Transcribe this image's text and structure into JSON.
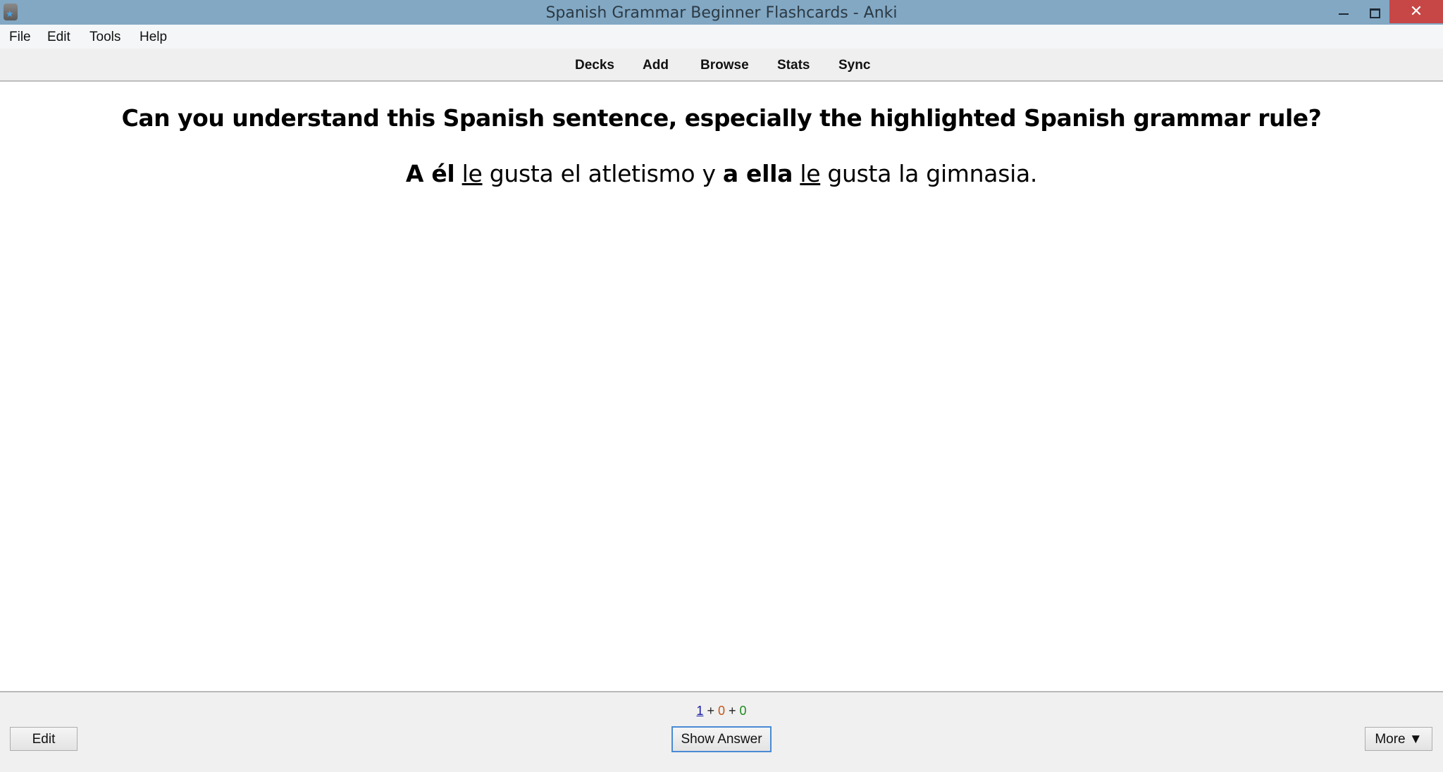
{
  "window": {
    "title": "Spanish Grammar Beginner Flashcards - Anki",
    "icons": {
      "app": "anki-star-icon",
      "minimize": "minimize-icon",
      "restore": "restore-icon",
      "close": "close-icon"
    },
    "close_glyph": "✕"
  },
  "menubar": {
    "items": [
      {
        "label": "File"
      },
      {
        "label": "Edit"
      },
      {
        "label": "Tools"
      },
      {
        "label": "Help"
      }
    ]
  },
  "toolbar": {
    "items": [
      {
        "label": "Decks"
      },
      {
        "label": "Add"
      },
      {
        "label": "Browse"
      },
      {
        "label": "Stats"
      },
      {
        "label": "Sync"
      }
    ]
  },
  "card": {
    "question": "Can you understand this Spanish sentence, especially the highlighted Spanish grammar rule?",
    "sentence": {
      "part1_bold": "A él",
      "part2_underline": "le",
      "part3": "gusta el atletismo y",
      "part4_bold": "a ella",
      "part5_underline": "le",
      "part6": "gusta la gimnasia."
    }
  },
  "bottombar": {
    "counts": {
      "new": "1",
      "learning": "0",
      "review": "0",
      "separator": "+"
    },
    "edit_label": "Edit",
    "show_answer_label": "Show Answer",
    "more_label": "More ▼"
  },
  "colors": {
    "titlebar": "#82a8c4",
    "close_button": "#c74646",
    "new_count": "#1a1aa6",
    "learning_count": "#c35617",
    "review_count": "#1f8a1f",
    "focus_border": "#4a8ad4"
  }
}
